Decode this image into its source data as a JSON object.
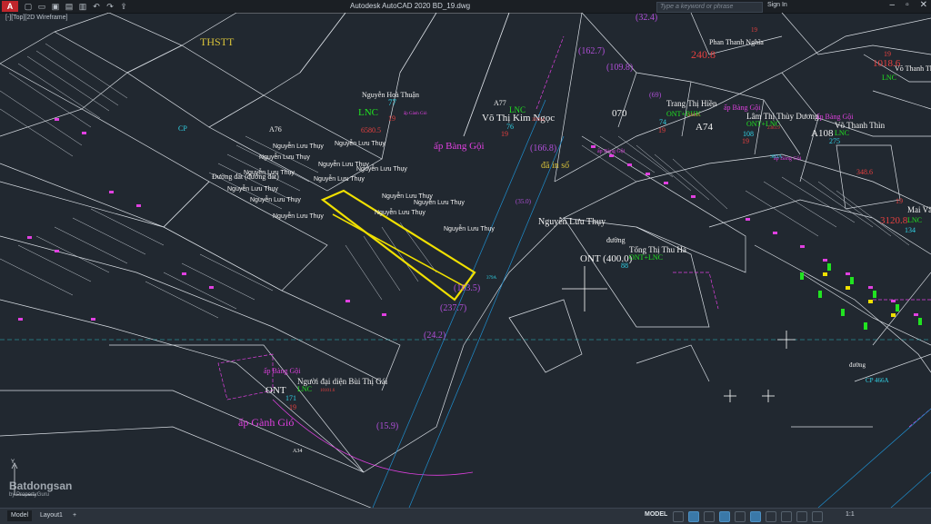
{
  "window": {
    "title": "Autodesk AutoCAD 2020   BD_19.dwg",
    "search_placeholder": "Type a keyword or phrase",
    "sign_in": "Sign In",
    "app_icon": "A"
  },
  "viewport_label": "[-][Top][2D Wireframe]",
  "drawing": {
    "labels": [
      {
        "text": "THSTT",
        "color": "#d8c23a"
      },
      {
        "text": "Nguyễn Hoà Thuận",
        "color": "#f2f2f2"
      },
      {
        "text": "LNC",
        "color": "#21e321"
      },
      {
        "text": "77",
        "color": "#31d4e8"
      },
      {
        "text": "19",
        "color": "#e6403f"
      },
      {
        "text": "6580.5",
        "color": "#e6403f"
      },
      {
        "text": "ấp Gành Gió",
        "color": "#e040e0"
      },
      {
        "text": "A77",
        "color": "#f2f2f2"
      },
      {
        "text": "Võ Thị Kim Ngọc",
        "color": "#f2f2f2"
      },
      {
        "text": "LNC",
        "color": "#21e321"
      },
      {
        "text": "76",
        "color": "#31d4e8"
      },
      {
        "text": "19",
        "color": "#e6403f"
      },
      {
        "text": "2929.4",
        "color": "#e6403f"
      },
      {
        "text": "ấp Bàng Gội",
        "color": "#e040e0"
      },
      {
        "text": "A76",
        "color": "#f2f2f2"
      },
      {
        "text": "đã in sổ",
        "color": "#d8c23a"
      },
      {
        "text": "Nguyễn Lưu Thụy",
        "color": "#f2f2f2"
      },
      {
        "text": "(166.8)",
        "color": "#b04fd8"
      },
      {
        "text": "(162.7)",
        "color": "#b04fd8"
      },
      {
        "text": "(109.8)",
        "color": "#b04fd8"
      },
      {
        "text": "(163.5)",
        "color": "#b04fd8"
      },
      {
        "text": "(237.7)",
        "color": "#b04fd8"
      },
      {
        "text": "(24.2)",
        "color": "#b04fd8"
      },
      {
        "text": "(15.9)",
        "color": "#b04fd8"
      },
      {
        "text": "(32.4)",
        "color": "#b04fd8"
      },
      {
        "text": "(35.0)",
        "color": "#b04fd8"
      },
      {
        "text": "(69)",
        "color": "#b04fd8"
      },
      {
        "text": "070",
        "color": "#f2f2f2"
      },
      {
        "text": "Trang Thị Hiền",
        "color": "#f2f2f2"
      },
      {
        "text": "ONT+BHK",
        "color": "#21e321"
      },
      {
        "text": "74",
        "color": "#31d4e8"
      },
      {
        "text": "19",
        "color": "#e6403f"
      },
      {
        "text": "3456.8",
        "color": "#e6403f"
      },
      {
        "text": "ấp Bàng Gội",
        "color": "#e040e0"
      },
      {
        "text": "A74",
        "color": "#f2f2f2"
      },
      {
        "text": "Lâm Thị Thùy Dương",
        "color": "#f2f2f2"
      },
      {
        "text": "ONT+LNC",
        "color": "#21e321"
      },
      {
        "text": "108",
        "color": "#31d4e8"
      },
      {
        "text": "19",
        "color": "#e6403f"
      },
      {
        "text": "2383.9",
        "color": "#e6403f"
      },
      {
        "text": "ấp Bàng Gội",
        "color": "#e040e0"
      },
      {
        "text": "A108",
        "color": "#f2f2f2"
      },
      {
        "text": "Võ Thanh Thìn",
        "color": "#f2f2f2"
      },
      {
        "text": "LNC",
        "color": "#21e321"
      },
      {
        "text": "275",
        "color": "#31d4e8"
      },
      {
        "text": "19",
        "color": "#e6403f"
      },
      {
        "text": "240.8",
        "color": "#e6403f"
      },
      {
        "text": "Phan Thanh Nghĩa",
        "color": "#f2f2f2"
      },
      {
        "text": "đường",
        "color": "#f2f2f2"
      },
      {
        "text": "ONT (400.0)",
        "color": "#f2f2f2"
      },
      {
        "text": "Tống Thị Thu Hà",
        "color": "#f2f2f2"
      },
      {
        "text": "ONT+LNC",
        "color": "#21e321"
      },
      {
        "text": "88",
        "color": "#31d4e8"
      },
      {
        "text": "19",
        "color": "#e6403f"
      },
      {
        "text": "3120.8",
        "color": "#e6403f"
      },
      {
        "text": "Mai Văn",
        "color": "#f2f2f2"
      },
      {
        "text": "LNC",
        "color": "#21e321"
      },
      {
        "text": "134",
        "color": "#31d4e8"
      },
      {
        "text": "19",
        "color": "#e6403f"
      },
      {
        "text": "1018.6",
        "color": "#e6403f"
      },
      {
        "text": "Võ Thanh Thìn",
        "color": "#f2f2f2"
      },
      {
        "text": "LNC",
        "color": "#21e321"
      },
      {
        "text": "348.6",
        "color": "#e6403f"
      },
      {
        "text": "ấp Bàng Gội",
        "color": "#e040e0"
      },
      {
        "text": "ONT",
        "color": "#f2f2f2"
      },
      {
        "text": "Người đại diện Bùi Thị Gái",
        "color": "#f2f2f2"
      },
      {
        "text": "LNC",
        "color": "#21e321"
      },
      {
        "text": "171",
        "color": "#31d4e8"
      },
      {
        "text": "19",
        "color": "#e6403f"
      },
      {
        "text": "10101.6",
        "color": "#e6403f"
      },
      {
        "text": "ấp Gành Gió",
        "color": "#e040e0"
      },
      {
        "text": "A34",
        "color": "#f2f2f2"
      },
      {
        "text": "đường",
        "color": "#f2f2f2"
      },
      {
        "text": "CP 466A",
        "color": "#31d4e8"
      },
      {
        "text": "ấp Bàng Gội",
        "color": "#e040e0"
      },
      {
        "text": "ấp Bàng Gội",
        "color": "#e040e0"
      },
      {
        "text": "383A",
        "color": "#31d4e8"
      },
      {
        "text": "379A",
        "color": "#31d4e8"
      },
      {
        "text": "CP",
        "color": "#31d4e8"
      },
      {
        "text": "Đường đất (đường đất)",
        "color": "#f2f2f2"
      }
    ]
  },
  "statusbar": {
    "tabs": [
      "Model",
      "Layout1",
      "+"
    ],
    "model_button": "MODEL",
    "scale": "1:1"
  },
  "watermark": {
    "brand": "Batdongsan",
    "sub": "by PropertyGuru",
    "domain": ".com.vn"
  }
}
